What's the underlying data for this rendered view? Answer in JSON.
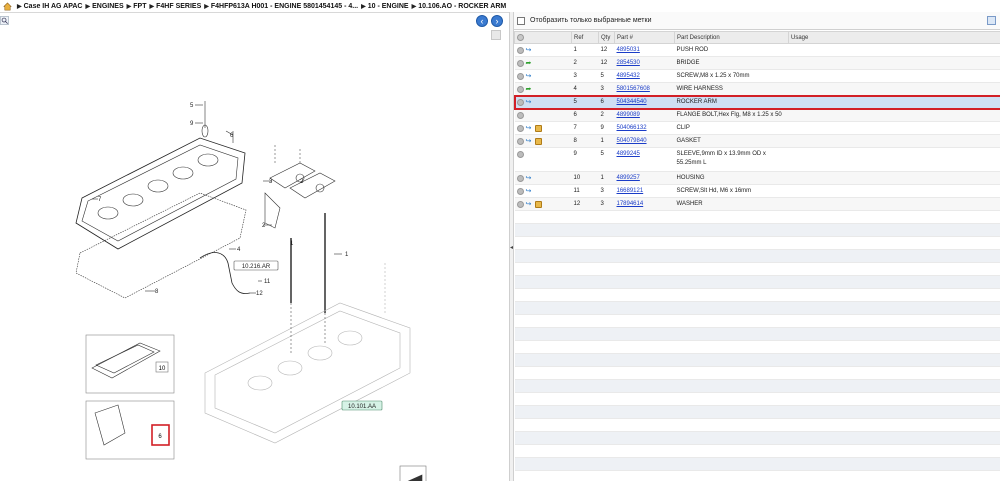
{
  "breadcrumb": {
    "items": [
      "Case IH AG APAC",
      "ENGINES",
      "FPT",
      "F4HF SERIES",
      "F4HFP613A H001 - ENGINE 5801454145 - 4...",
      "10 - ENGINE",
      "10.106.AO - ROCKER ARM"
    ]
  },
  "diagram": {
    "callouts": [
      "5",
      "9",
      "6",
      "7",
      "3",
      "2",
      "4",
      "1",
      "8",
      "11",
      "12",
      "1",
      "2"
    ],
    "ref_labels": [
      "10.216.AR",
      "10.101.AA"
    ],
    "thumb_labels": [
      "10",
      "6"
    ]
  },
  "filter": {
    "label": "Отобразить только выбранные метки",
    "checked": false
  },
  "table": {
    "headers": [
      "Ref",
      "Qty",
      "Part #",
      "Part Description",
      "Usage"
    ],
    "rows": [
      {
        "ref": "1",
        "qty": "12",
        "part": "4895031",
        "desc": "PUSH ROD",
        "usage": "",
        "icons": [
          "add-icon",
          "swap-icon"
        ]
      },
      {
        "ref": "2",
        "qty": "12",
        "part": "2854530",
        "desc": "BRIDGE",
        "usage": "",
        "icons": [
          "add-icon",
          "green-arrow-icon"
        ]
      },
      {
        "ref": "3",
        "qty": "5",
        "part": "4895432",
        "desc": "SCREW,M8 x 1.25 x 70mm",
        "usage": "",
        "icons": [
          "add-icon",
          "swap-icon"
        ]
      },
      {
        "ref": "4",
        "qty": "3",
        "part": "5801567608",
        "desc": "WIRE HARNESS",
        "usage": "",
        "icons": [
          "add-icon",
          "green-arrow-icon"
        ]
      },
      {
        "ref": "5",
        "qty": "6",
        "part": "504344540",
        "desc": "ROCKER ARM",
        "usage": "",
        "icons": [
          "add-icon",
          "swap-icon"
        ],
        "selected": true
      },
      {
        "ref": "6",
        "qty": "2",
        "part": "4899089",
        "desc": "FLANGE BOLT,Hex Flg, M8 x 1.25 x 50",
        "usage": "",
        "icons": [
          "add-icon"
        ]
      },
      {
        "ref": "7",
        "qty": "9",
        "part": "504066132",
        "desc": "CLIP",
        "usage": "",
        "icons": [
          "add-icon",
          "swap-icon",
          "kit-icon"
        ]
      },
      {
        "ref": "8",
        "qty": "1",
        "part": "504079840",
        "desc": "GASKET",
        "usage": "",
        "icons": [
          "add-icon",
          "swap-icon",
          "kit-icon"
        ]
      },
      {
        "ref": "9",
        "qty": "5",
        "part": "4899245",
        "desc": "SLEEVE,9mm ID x 13.9mm OD x 55.25mm L",
        "usage": "",
        "icons": [
          "add-icon"
        ],
        "tall": true
      },
      {
        "ref": "10",
        "qty": "1",
        "part": "4899257",
        "desc": "HOUSING",
        "usage": "",
        "icons": [
          "add-icon",
          "swap-icon"
        ]
      },
      {
        "ref": "11",
        "qty": "3",
        "part": "16689121",
        "desc": "SCREW,Slt Hd, M6 x 16mm",
        "usage": "",
        "icons": [
          "add-icon",
          "swap-icon"
        ]
      },
      {
        "ref": "12",
        "qty": "3",
        "part": "17894614",
        "desc": "WASHER",
        "usage": "",
        "icons": [
          "add-icon",
          "swap-icon",
          "kit-icon"
        ]
      }
    ]
  },
  "colors": {
    "selected_row": "#cfdff3",
    "highlight_border": "#d21f26",
    "link": "#1a3cc8",
    "nav_button": "#3a7ad0"
  }
}
